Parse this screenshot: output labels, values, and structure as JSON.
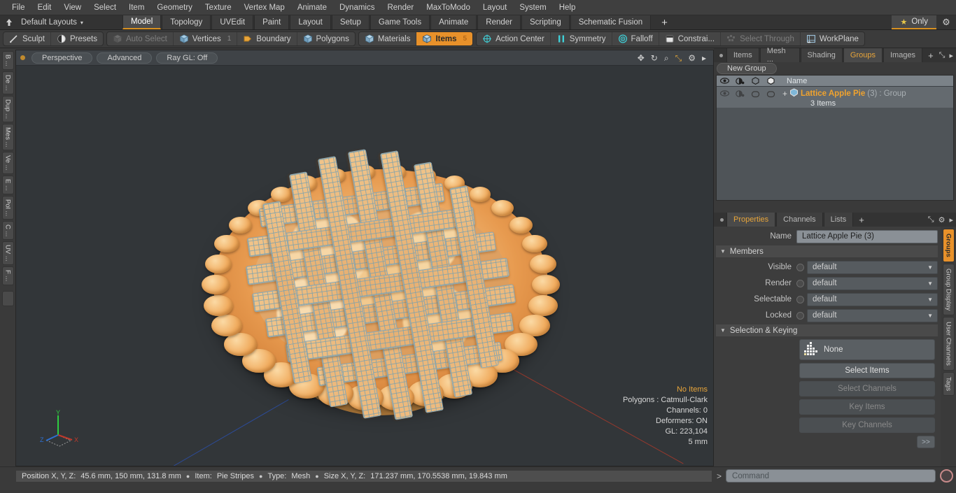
{
  "app": {
    "menu": [
      "File",
      "Edit",
      "View",
      "Select",
      "Item",
      "Geometry",
      "Texture",
      "Vertex Map",
      "Animate",
      "Dynamics",
      "Render",
      "MaxToModo",
      "Layout",
      "System",
      "Help"
    ],
    "accent_orange": "#e8912a",
    "panel_bg": "#3a3a3a"
  },
  "layout_bar": {
    "layouts_label": "Default Layouts",
    "caret": "▾",
    "tabs": [
      {
        "label": "Model",
        "active": true
      },
      {
        "label": "Topology",
        "active": false
      },
      {
        "label": "UVEdit",
        "active": false
      },
      {
        "label": "Paint",
        "active": false
      },
      {
        "label": "Layout",
        "active": false
      },
      {
        "label": "Setup",
        "active": false
      },
      {
        "label": "Game Tools",
        "active": false
      },
      {
        "label": "Animate",
        "active": false
      },
      {
        "label": "Render",
        "active": false
      },
      {
        "label": "Scripting",
        "active": false
      },
      {
        "label": "Schematic Fusion",
        "active": false
      }
    ],
    "add_tab": "+",
    "only_label": "Only",
    "only_star": "★",
    "gear": "⚙"
  },
  "toolbar": {
    "group1": [
      {
        "label": "Sculpt",
        "icon": "pencil-icon",
        "state": "normal",
        "count": ""
      },
      {
        "label": "Presets",
        "icon": "sphere-icon",
        "state": "normal",
        "count": ""
      }
    ],
    "group2": [
      {
        "label": "Auto Select",
        "icon": "cube-grey-icon",
        "state": "dim",
        "count": ""
      },
      {
        "label": "Vertices",
        "icon": "cube-blue-icon",
        "state": "normal",
        "count": "1"
      },
      {
        "label": "Boundary",
        "icon": "boundary-icon",
        "state": "normal",
        "count": ""
      },
      {
        "label": "Polygons",
        "icon": "cube-poly-icon",
        "state": "normal",
        "count": ""
      }
    ],
    "group3": [
      {
        "label": "Materials",
        "icon": "cube-materials-icon",
        "state": "normal",
        "count": ""
      },
      {
        "label": "Items",
        "icon": "cube-items-icon",
        "state": "selected",
        "count": "5"
      }
    ],
    "group4": [
      {
        "label": "Action Center",
        "icon": "target-icon",
        "state": "normal",
        "count": ""
      },
      {
        "label": "Symmetry",
        "icon": "symmetry-icon",
        "state": "normal",
        "count": ""
      },
      {
        "label": "Falloff",
        "icon": "falloff-icon",
        "state": "normal",
        "count": ""
      },
      {
        "label": "Constrai...",
        "icon": "constrain-icon",
        "state": "normal",
        "count": ""
      },
      {
        "label": "Select Through",
        "icon": "select-through-icon",
        "state": "dim",
        "count": ""
      },
      {
        "label": "WorkPlane",
        "icon": "workplane-icon",
        "state": "normal",
        "count": ""
      }
    ]
  },
  "left_strip": {
    "tabs": [
      "B ...",
      "De ...",
      "Dup ...",
      "Mes ...",
      "Ve ...",
      "E ...",
      "Pol ...",
      "C ...",
      "UV ...",
      "F ..."
    ]
  },
  "viewport": {
    "pills": [
      "Perspective",
      "Advanced",
      "Ray GL: Off"
    ],
    "icons": [
      "move-icon",
      "rotate-icon",
      "zoom-icon",
      "fit-icon",
      "gear-icon",
      "play-icon"
    ],
    "icon_glyphs": [
      "✥",
      "↻",
      "⌕",
      "⤡",
      "⚙",
      "▸"
    ],
    "gizmo": {
      "x": "X",
      "y": "Y",
      "z": "Z",
      "x_color": "#c0392b",
      "y_color": "#2ecc40",
      "z_color": "#2d6fd0"
    },
    "stats": [
      {
        "text": "No Items",
        "highlight": true
      },
      {
        "text": "Polygons : Catmull-Clark",
        "highlight": false
      },
      {
        "text": "Channels: 0",
        "highlight": false
      },
      {
        "text": "Deformers: ON",
        "highlight": false
      },
      {
        "text": "GL: 223,104",
        "highlight": false
      },
      {
        "text": "5 mm",
        "highlight": false
      }
    ]
  },
  "groups_panel": {
    "tabs": [
      {
        "label": "Items",
        "active": false
      },
      {
        "label": "Mesh ...",
        "active": false
      },
      {
        "label": "Shading",
        "active": false
      },
      {
        "label": "Groups",
        "active": true
      },
      {
        "label": "Images",
        "active": false
      }
    ],
    "add_tab": "+",
    "expand_glyph": "⤡",
    "arrow_glyph": "▸",
    "new_group_label": "New Group",
    "column_icons": [
      "eye-icon",
      "render-icon",
      "wireframe-icon",
      "shaded-icon"
    ],
    "name_column": "Name",
    "rows": [
      {
        "expander": "+",
        "icon": "group-icon",
        "name": "Lattice Apple Pie",
        "count": "(3)",
        "type": ": Group",
        "subtitle": "3 Items"
      }
    ]
  },
  "properties_panel": {
    "tabs": [
      {
        "label": "Properties",
        "active": true
      },
      {
        "label": "Channels",
        "active": false
      },
      {
        "label": "Lists",
        "active": false
      }
    ],
    "add_tab": "+",
    "expand_glyph": "⤡",
    "gear_glyph": "⚙",
    "arrow_glyph": "▸",
    "name_label": "Name",
    "name_value": "Lattice Apple Pie (3)",
    "members_section": "Members",
    "members_fields": [
      {
        "label": "Visible",
        "value": "default"
      },
      {
        "label": "Render",
        "value": "default"
      },
      {
        "label": "Selectable",
        "value": "default"
      },
      {
        "label": "Locked",
        "value": "default"
      }
    ],
    "selection_section": "Selection & Keying",
    "selection_dropdown": "None",
    "buttons": [
      {
        "label": "Select Items",
        "enabled": true
      },
      {
        "label": "Select Channels",
        "enabled": false
      },
      {
        "label": "Key Items",
        "enabled": false
      },
      {
        "label": "Key Channels",
        "enabled": false
      }
    ],
    "more_button": ">>"
  },
  "right_strip": {
    "tabs": [
      {
        "label": "Groups",
        "active": true
      },
      {
        "label": "Group Display",
        "active": false
      },
      {
        "label": "User Channels",
        "active": false
      },
      {
        "label": "Tags",
        "active": false
      }
    ]
  },
  "status_bar": {
    "position_label": "Position X, Y, Z:",
    "position_value": "45.6 mm, 150 mm, 131.8 mm",
    "item_label": "Item:",
    "item_value": "Pie Stripes",
    "type_label": "Type:",
    "type_value": "Mesh",
    "size_label": "Size X, Y, Z:",
    "size_value": "171.237 mm, 170.5538 mm, 19.843 mm",
    "separator": "●",
    "prompt": ">",
    "command_placeholder": "Command",
    "record_button": "record-icon"
  }
}
